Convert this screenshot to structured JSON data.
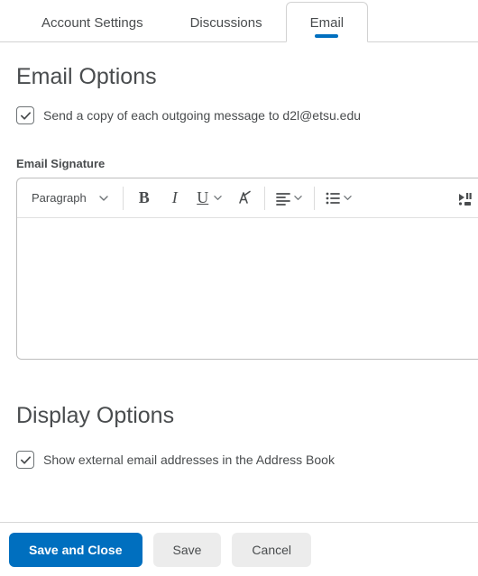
{
  "tabs": {
    "account_settings": "Account Settings",
    "discussions": "Discussions",
    "email": "Email"
  },
  "sections": {
    "email_options": "Email Options",
    "display_options": "Display Options"
  },
  "checkboxes": {
    "send_copy": "Send a copy of each outgoing message to d2l@etsu.edu",
    "show_external": "Show external email addresses in the Address Book"
  },
  "editor": {
    "signature_label": "Email Signature",
    "paragraph_label": "Paragraph"
  },
  "buttons": {
    "save_close": "Save and Close",
    "save": "Save",
    "cancel": "Cancel"
  }
}
